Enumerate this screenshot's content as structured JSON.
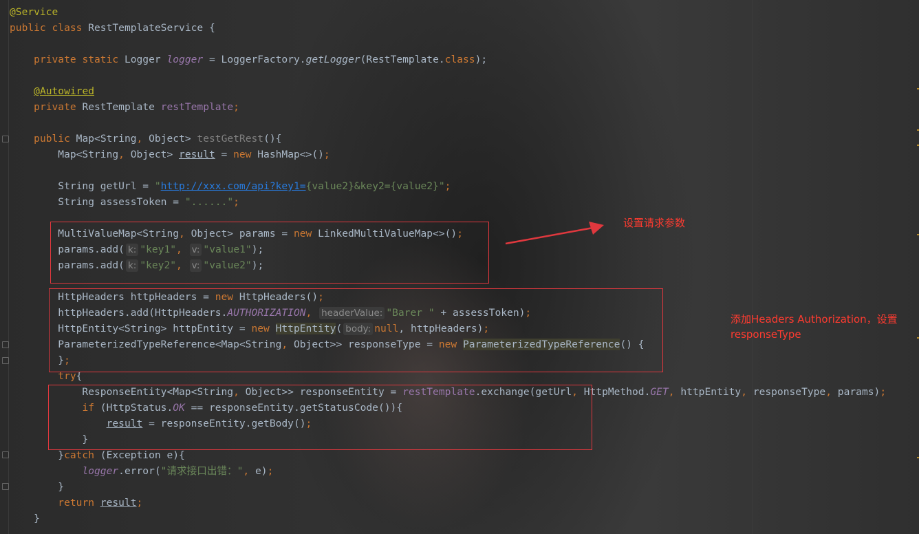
{
  "editor": {
    "lines": [
      [
        {
          "t": "@Service",
          "c": "ann"
        }
      ],
      [
        {
          "t": "public class ",
          "c": "kw"
        },
        {
          "t": "RestTemplateService {"
        }
      ],
      [],
      [
        {
          "t": "    "
        },
        {
          "t": "private static ",
          "c": "kw"
        },
        {
          "t": "Logger "
        },
        {
          "t": "logger",
          "c": "fieldv italic"
        },
        {
          "t": " = LoggerFactory."
        },
        {
          "t": "getLogger",
          "c": "italic"
        },
        {
          "t": "(RestTemplate."
        },
        {
          "t": "class",
          "c": "kw"
        },
        {
          "t": ");"
        }
      ],
      [],
      [
        {
          "t": "    "
        },
        {
          "t": "@Autowired",
          "c": "ann ul"
        }
      ],
      [
        {
          "t": "    "
        },
        {
          "t": "private ",
          "c": "kw"
        },
        {
          "t": "RestTemplate "
        },
        {
          "t": "restTemplate",
          "c": "fieldv"
        },
        {
          "t": ";",
          "c": "kw"
        }
      ],
      [],
      [
        {
          "t": "    "
        },
        {
          "t": "public ",
          "c": "kw"
        },
        {
          "t": "Map<String"
        },
        {
          "t": ", ",
          "c": "kw"
        },
        {
          "t": "Object> "
        },
        {
          "t": "testGetRest",
          "c": "gray"
        },
        {
          "t": "(){"
        }
      ],
      [
        {
          "t": "        Map<String"
        },
        {
          "t": ", ",
          "c": "kw"
        },
        {
          "t": "Object> "
        },
        {
          "t": "result",
          "c": "ul"
        },
        {
          "t": " = "
        },
        {
          "t": "new ",
          "c": "kw"
        },
        {
          "t": "HashMap<>()"
        },
        {
          "t": ";",
          "c": "kw"
        }
      ],
      [],
      [
        {
          "t": "        String getUrl = "
        },
        {
          "t": "\"",
          "c": "str"
        },
        {
          "t": "http://xxx.com/api?key1=",
          "c": "url"
        },
        {
          "t": "{value2}&key2={value2}\"",
          "c": "str"
        },
        {
          "t": ";",
          "c": "kw"
        }
      ],
      [
        {
          "t": "        String assessToken = "
        },
        {
          "t": "\"......\"",
          "c": "str"
        },
        {
          "t": ";",
          "c": "kw"
        }
      ],
      [],
      [
        {
          "t": "        MultiValueMap<String"
        },
        {
          "t": ", ",
          "c": "kw"
        },
        {
          "t": "Object> params = "
        },
        {
          "t": "new ",
          "c": "kw"
        },
        {
          "t": "LinkedMultiValueMap<>()"
        },
        {
          "t": ";",
          "c": "kw"
        }
      ],
      [
        {
          "t": "        params.add("
        },
        {
          "h": "k:"
        },
        {
          "t": "\"key1\"",
          "c": "str"
        },
        {
          "t": ", ",
          "c": "kw"
        },
        {
          "h": "v:"
        },
        {
          "t": "\"value1\"",
          "c": "str"
        },
        {
          "t": ");"
        }
      ],
      [
        {
          "t": "        params.add("
        },
        {
          "h": "k:"
        },
        {
          "t": "\"key2\"",
          "c": "str"
        },
        {
          "t": ", ",
          "c": "kw"
        },
        {
          "h": "v:"
        },
        {
          "t": "\"value2\"",
          "c": "str"
        },
        {
          "t": ");"
        }
      ],
      [],
      [
        {
          "t": "        HttpHeaders httpHeaders = "
        },
        {
          "t": "new ",
          "c": "kw"
        },
        {
          "t": "HttpHeaders()"
        },
        {
          "t": ";",
          "c": "kw"
        }
      ],
      [
        {
          "t": "        httpHeaders.add(HttpHeaders."
        },
        {
          "t": "AUTHORIZATION",
          "c": "fieldv italic"
        },
        {
          "t": ", ",
          "c": "kw"
        },
        {
          "h": "headerValue:"
        },
        {
          "t": "\"Barer \"",
          "c": "str"
        },
        {
          "t": " + assessToken)"
        },
        {
          "t": ";",
          "c": "kw"
        }
      ],
      [
        {
          "t": "        HttpEntity<String> httpEntity = "
        },
        {
          "t": "new ",
          "c": "kw"
        },
        {
          "t": "HttpEntity",
          "c": "hl"
        },
        {
          "t": "("
        },
        {
          "h": "body:"
        },
        {
          "t": "null",
          "c": "kw"
        },
        {
          "t": ", httpHeaders)"
        },
        {
          "t": ";",
          "c": "kw"
        }
      ],
      [
        {
          "t": "        ParameterizedTypeReference<Map<String"
        },
        {
          "t": ", ",
          "c": "kw"
        },
        {
          "t": "Object>> responseType = "
        },
        {
          "t": "new ",
          "c": "kw"
        },
        {
          "t": "ParameterizedTypeReference",
          "c": "hl"
        },
        {
          "t": "() {"
        }
      ],
      [
        {
          "t": "        }"
        },
        {
          "t": ";",
          "c": "kw"
        }
      ],
      [
        {
          "t": "        "
        },
        {
          "t": "try",
          "c": "kw"
        },
        {
          "t": "{"
        }
      ],
      [
        {
          "t": "            ResponseEntity<Map<String"
        },
        {
          "t": ", ",
          "c": "kw"
        },
        {
          "t": "Object>> responseEntity = "
        },
        {
          "t": "restTemplate",
          "c": "fieldv"
        },
        {
          "t": ".exchange(getUrl"
        },
        {
          "t": ", ",
          "c": "kw"
        },
        {
          "t": "HttpMethod."
        },
        {
          "t": "GET",
          "c": "fieldv italic"
        },
        {
          "t": ", ",
          "c": "kw"
        },
        {
          "t": "httpEntity"
        },
        {
          "t": ", ",
          "c": "kw"
        },
        {
          "t": "responseType"
        },
        {
          "t": ", ",
          "c": "kw"
        },
        {
          "t": "params)"
        },
        {
          "t": ";",
          "c": "kw"
        }
      ],
      [
        {
          "t": "            "
        },
        {
          "t": "if ",
          "c": "kw"
        },
        {
          "t": "(HttpStatus."
        },
        {
          "t": "OK",
          "c": "fieldv italic"
        },
        {
          "t": " == responseEntity.getStatusCode()){"
        }
      ],
      [
        {
          "t": "                "
        },
        {
          "t": "result",
          "c": "ul"
        },
        {
          "t": " = responseEntity.getBody()"
        },
        {
          "t": ";",
          "c": "kw"
        }
      ],
      [
        {
          "t": "            }"
        }
      ],
      [
        {
          "t": "        }"
        },
        {
          "t": "catch ",
          "c": "kw"
        },
        {
          "t": "(Exception e){"
        }
      ],
      [
        {
          "t": "            "
        },
        {
          "t": "logger",
          "c": "fieldv italic"
        },
        {
          "t": ".error("
        },
        {
          "t": "\"请求接口出错：\"",
          "c": "str"
        },
        {
          "t": ", ",
          "c": "kw"
        },
        {
          "t": "e)"
        },
        {
          "t": ";",
          "c": "kw"
        }
      ],
      [
        {
          "t": "        }"
        }
      ],
      [
        {
          "t": "        "
        },
        {
          "t": "return ",
          "c": "kw"
        },
        {
          "t": "result",
          "c": "ul"
        },
        {
          "t": ";",
          "c": "kw"
        }
      ],
      [
        {
          "t": "    }"
        }
      ]
    ]
  },
  "annotations": {
    "params_note": "设置请求参数",
    "headers_note": "添加Headers Authorization，设置responseType"
  }
}
